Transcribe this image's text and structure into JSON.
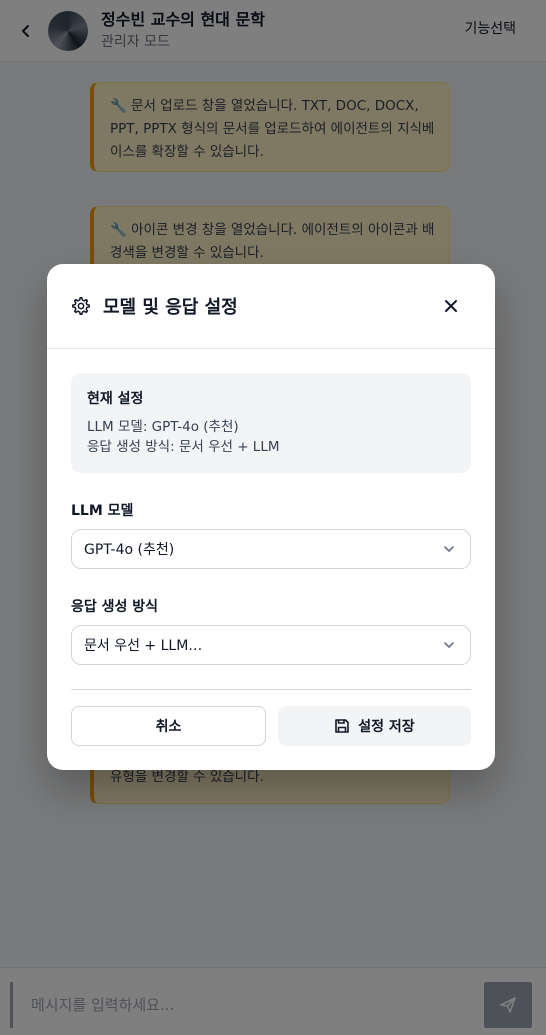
{
  "header": {
    "title": "정수빈 교수의 현대 문학",
    "subtitle": "관리자 모드",
    "action_label": "기능선택"
  },
  "messages": [
    {
      "text": "🔧 문서 업로드 창을 열었습니다. TXT, DOC, DOCX, PPT, PPTX 형식의 문서를 업로드하여 에이전트의 지식베이스를 확장할 수 있습니다."
    },
    {
      "text": "🔧 아이콘 변경 창을 열었습니다. 에이전트의 아이콘과 배경색을 변경할 수 있습니다."
    },
    {
      "text": "유형을 변경할 수 있습니다."
    }
  ],
  "composer": {
    "placeholder": "메시지를 입력하세요..."
  },
  "modal": {
    "title": "모델 및 응답 설정",
    "current": {
      "title": "현재 설정",
      "model_line": "LLM 모델: GPT-4o (추천)",
      "mode_line": "응답 생성 방식: 문서 우선 + LLM"
    },
    "model_field": {
      "label": "LLM 모델",
      "selected": "GPT-4o (추천)"
    },
    "mode_field": {
      "label": "응답 생성 방식",
      "selected": "문서 우선 + LLM…"
    },
    "cancel_label": "취소",
    "save_label": "설정 저장"
  },
  "colors": {
    "accent_notice": "#f59e0b",
    "notice_bg": "#fef3c7",
    "overlay": "rgba(0,0,0,0.5)"
  },
  "icons": {
    "back": "chevron-left-icon",
    "settings": "gear-icon",
    "close": "close-icon",
    "dropdown": "chevron-down-icon",
    "save": "save-icon",
    "send": "send-icon"
  }
}
